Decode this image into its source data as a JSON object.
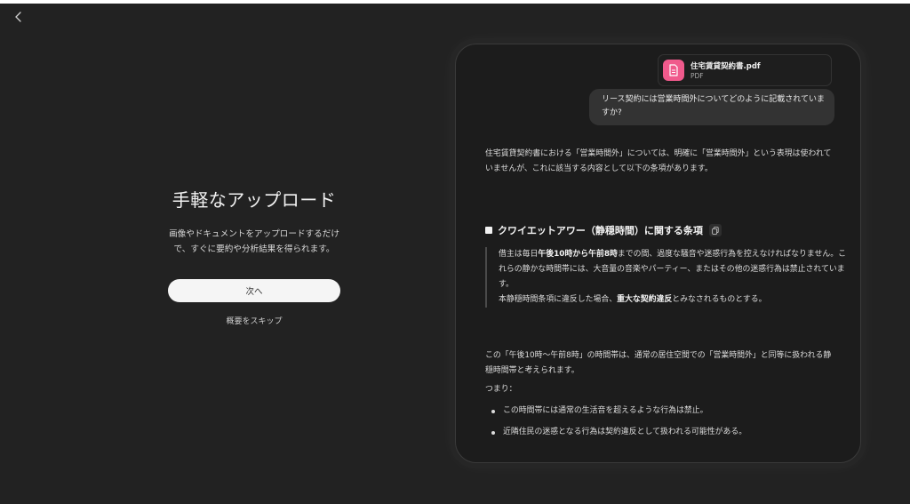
{
  "onboarding": {
    "title": "手軽なアップロード",
    "description": "画像やドキュメントをアップロードするだけで、すぐに要約や分析結果を得られます。",
    "next_label": "次へ",
    "skip_label": "概要をスキップ"
  },
  "chat": {
    "attachment": {
      "name": "住宅賃貸契約書.pdf",
      "type": "PDF",
      "icon": "document-icon",
      "icon_color": "#f05a8c"
    },
    "user_message": "リース契約には営業時間外についてどのように記載されていますか?",
    "answer": {
      "intro": "住宅賃貸契約書における「営業時間外」については、明確に「営業時間外」という表現は使われていませんが、これに該当する内容として以下の条項があります。",
      "section_title": "クワイエットアワー（静穏時間）に関する条項",
      "quote": {
        "line1_pre": "借主は毎日",
        "line1_bold": "午後10時から午前8時",
        "line1_post": "までの間、過度な騒音や迷惑行為を控えなければなりません。これらの静かな時間帯には、大音量の音楽やパーティー、またはその他の迷惑行為は禁止されています。",
        "line2_pre": "本静穏時間条項に違反した場合、",
        "line2_bold": "重大な契約違反",
        "line2_post": "とみなされるものとする。"
      },
      "outro": "この「午後10時～午前8時」の時間帯は、通常の居住空間での「営業時間外」と同等に扱われる静穏時間帯と考えられます。",
      "so_label": "つまり：",
      "bullets": [
        "この時間帯には通常の生活音を超えるような行為は禁止。",
        "近隣住民の迷惑となる行為は契約違反として扱われる可能性がある。"
      ]
    }
  },
  "icons": {
    "back": "chevron-left-icon",
    "copy": "copy-icon",
    "bullet": "square-bullet-icon"
  }
}
